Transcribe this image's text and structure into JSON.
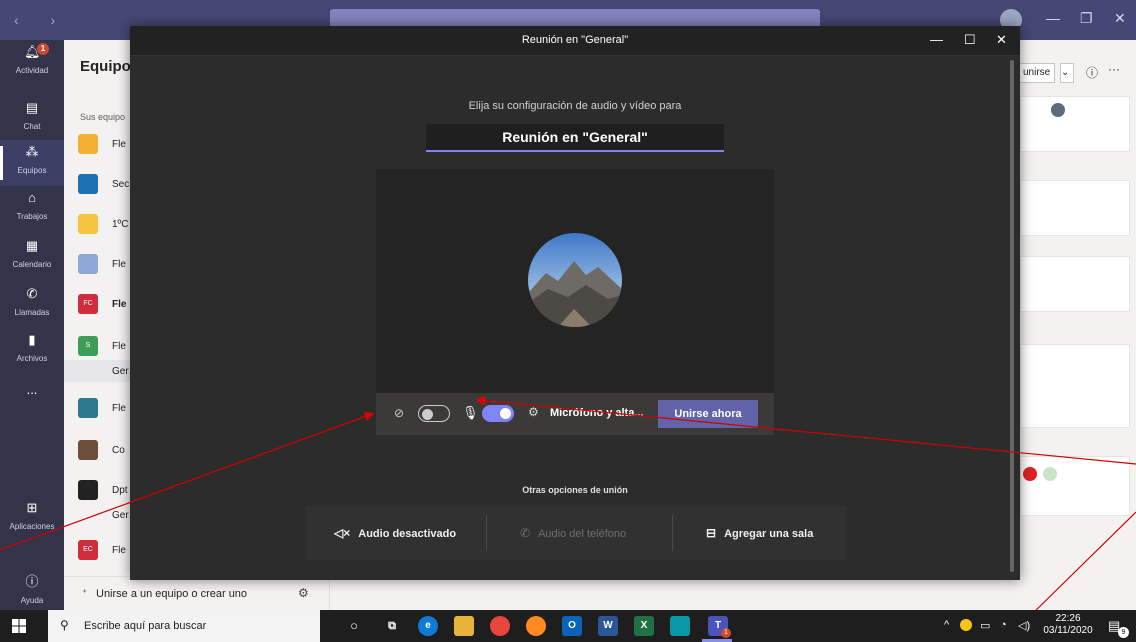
{
  "app": {
    "rail": [
      {
        "label": "Actividad",
        "badge": "1"
      },
      {
        "label": "Chat"
      },
      {
        "label": "Equipos",
        "active": true
      },
      {
        "label": "Trabajos"
      },
      {
        "label": "Calendario"
      },
      {
        "label": "Llamadas"
      },
      {
        "label": "Archivos"
      },
      {
        "label": "..."
      },
      {
        "label": "Aplicaciones"
      },
      {
        "label": "Ayuda"
      }
    ]
  },
  "teams_panel": {
    "title": "Equipo",
    "subtitle": "Sus equipo",
    "teams": [
      {
        "name": "Fle"
      },
      {
        "name": "Sec"
      },
      {
        "name": "1ºC"
      },
      {
        "name": "Fle"
      },
      {
        "name": "Fle",
        "initials": "FC"
      },
      {
        "name": "Fle",
        "initials": "S"
      },
      {
        "name": "Fle"
      },
      {
        "name": "Co"
      },
      {
        "name": "Dpt"
      },
      {
        "name": "Fle",
        "initials": "EC"
      }
    ],
    "channel_selected": "Ger",
    "channel_extra": "Ger",
    "join_create": "Unirse a un equipo o crear uno"
  },
  "channel_header": {
    "join_btn": "unirse",
    "more": "···"
  },
  "modal": {
    "title": "Reunión en \"General\"",
    "subtitle": "Elija su configuración de audio y vídeo para",
    "meeting_name": "Reunión en \"General\"",
    "device_settings": "Micrófono y alta...",
    "join_now": "Unirse ahora",
    "other_title": "Otras opciones de unión",
    "options": [
      {
        "label": "Audio desactivado",
        "icon": "speaker-off-icon",
        "enabled": true
      },
      {
        "label": "Audio del teléfono",
        "icon": "phone-icon",
        "enabled": false
      },
      {
        "label": "Agregar una sala",
        "icon": "room-icon",
        "enabled": true
      }
    ],
    "camera_on": false,
    "mic_on": true
  },
  "taskbar": {
    "search_placeholder": "Escribe aquí para buscar",
    "time": "22:26",
    "date": "03/11/2020",
    "notif_count": "9",
    "teams_badge": "1"
  }
}
